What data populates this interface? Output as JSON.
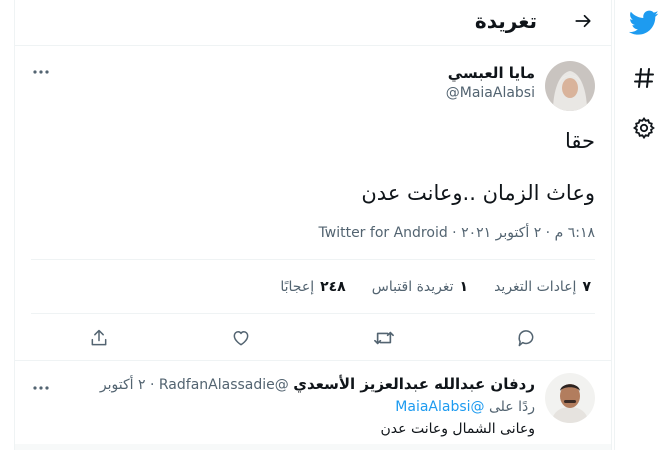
{
  "header": {
    "title": "تغريدة"
  },
  "rail": {
    "icons": [
      "twitter-bird-icon",
      "hashtag-icon",
      "gear-icon"
    ]
  },
  "colors": {
    "accent": "#1d9bf0",
    "text": "#0f1419",
    "muted": "#536471",
    "border": "#eff3f4"
  },
  "tweet": {
    "author_name": "مايا العبسي",
    "author_handle": "@MaiaAlabsi",
    "text_line1": "حقا",
    "text_line2": "وعاث الزمان ..وعانت عدن",
    "time": "٦:١٨ م",
    "date": "٢ أكتوبر ٢٠٢١",
    "source": "Twitter for Android",
    "stats": [
      {
        "count": "٧",
        "label": "إعادات التغريد"
      },
      {
        "count": "١",
        "label": "تغريدة اقتباس"
      },
      {
        "count": "٢٤٨",
        "label": "إعجابًا"
      }
    ],
    "actions": [
      "reply-icon",
      "retweet-icon",
      "like-icon",
      "share-icon"
    ]
  },
  "reply": {
    "name": "ردفان عبدالله عبدالعزيز الأسعدي",
    "handle": "@RadfanAlassadie",
    "date": "٢ أكتوبر",
    "replying_prefix": "ردًا على",
    "replying_to": "@MaiaAlabsi",
    "text": "وعانى الشمال وعانت عدن"
  }
}
